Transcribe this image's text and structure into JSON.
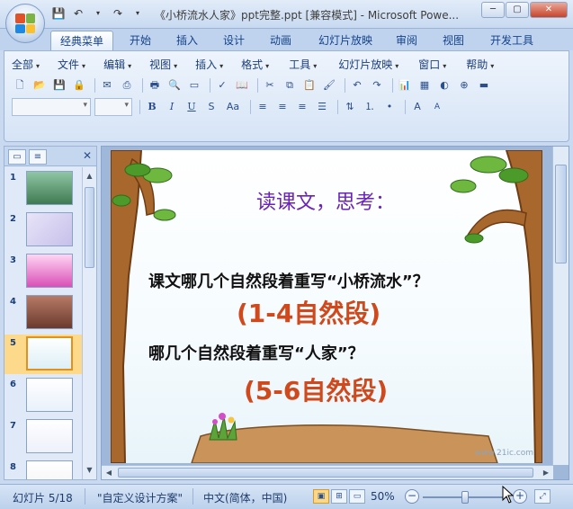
{
  "window": {
    "title": "《小桥流水人家》ppt完整.ppt [兼容模式] - Microsoft Powe...",
    "controls": {
      "minimize": "─",
      "maximize": "▢",
      "close": "✕"
    }
  },
  "tabs": [
    {
      "label": "经典菜单",
      "active": true
    },
    {
      "label": "开始"
    },
    {
      "label": "插入"
    },
    {
      "label": "设计"
    },
    {
      "label": "动画"
    },
    {
      "label": "幻灯片放映"
    },
    {
      "label": "审阅"
    },
    {
      "label": "视图"
    },
    {
      "label": "开发工具"
    }
  ],
  "menus": [
    "全部",
    "文件",
    "编辑",
    "视图",
    "插入",
    "格式",
    "工具",
    "幻灯片放映",
    "窗口",
    "帮助"
  ],
  "format_buttons": {
    "bold": "B",
    "italic": "I",
    "underline": "U",
    "shadow": "S",
    "case": "Aa"
  },
  "font_size_buttons": {
    "grow": "A",
    "shrink": "A"
  },
  "thumbnails": [
    {
      "num": "1"
    },
    {
      "num": "2"
    },
    {
      "num": "3"
    },
    {
      "num": "4"
    },
    {
      "num": "5",
      "selected": true
    },
    {
      "num": "6"
    },
    {
      "num": "7"
    },
    {
      "num": "8"
    }
  ],
  "slide": {
    "heading": "读课文，思考：",
    "question1": "课文哪几个自然段着重写“小桥流水”？",
    "answer1": "(1-4自然段)",
    "question2": "哪几个自然段着重写“人家”？",
    "answer2": "(5-6自然段)",
    "watermark": "www.21ic.com"
  },
  "status": {
    "slide_info": "幻灯片 5/18",
    "theme": "\"自定义设计方案\"",
    "language": "中文(简体，中国)",
    "zoom": "50%",
    "zoom_fraction": 0.5
  },
  "colors": {
    "accent": "#15428b",
    "heading": "#6a22b8",
    "answer": "#d0491c",
    "selected": "#fcd98b"
  }
}
